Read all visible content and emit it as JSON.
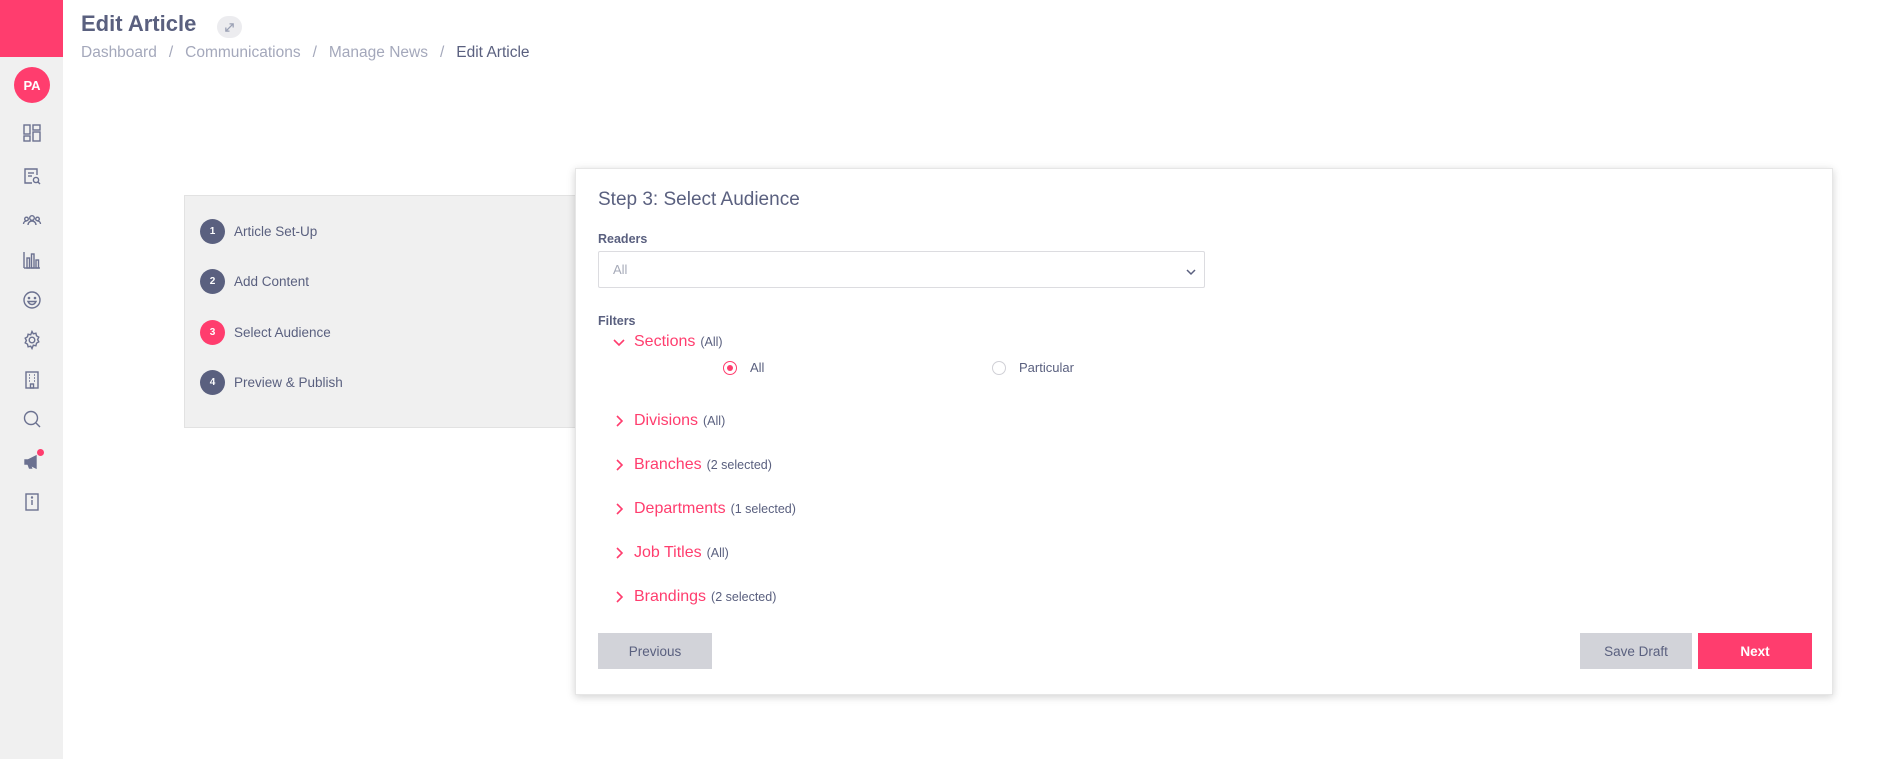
{
  "sidebar": {
    "avatar_initials": "PA",
    "brand_color": "#ff3d6e",
    "icons": [
      {
        "name": "dashboard-icon"
      },
      {
        "name": "document-search-icon"
      },
      {
        "name": "team-icon"
      },
      {
        "name": "analytics-icon"
      },
      {
        "name": "smiley-icon"
      },
      {
        "name": "settings-icon"
      },
      {
        "name": "building-icon"
      },
      {
        "name": "search-icon"
      },
      {
        "name": "megaphone-icon",
        "notification": true
      },
      {
        "name": "directory-icon"
      }
    ]
  },
  "header": {
    "title": "Edit Article",
    "breadcrumb": [
      "Dashboard",
      "Communications",
      "Manage News",
      "Edit Article"
    ],
    "separator": "/"
  },
  "steps": [
    {
      "number": "1",
      "label": "Article Set-Up",
      "active": false
    },
    {
      "number": "2",
      "label": "Add Content",
      "active": false
    },
    {
      "number": "3",
      "label": "Select Audience",
      "active": true
    },
    {
      "number": "4",
      "label": "Preview & Publish",
      "active": false
    }
  ],
  "form": {
    "title": "Step 3: Select Audience",
    "readers_label": "Readers",
    "readers_value": "All",
    "filters_label": "Filters",
    "filters": [
      {
        "name": "Sections",
        "detail": "(All)",
        "expanded": true
      },
      {
        "name": "Divisions",
        "detail": "(All)",
        "expanded": false
      },
      {
        "name": "Branches",
        "detail": "(2 selected)",
        "expanded": false
      },
      {
        "name": "Departments",
        "detail": "(1 selected)",
        "expanded": false
      },
      {
        "name": "Job Titles",
        "detail": "(All)",
        "expanded": false
      },
      {
        "name": "Brandings",
        "detail": "(2 selected)",
        "expanded": false
      }
    ],
    "sections_options": [
      {
        "label": "All",
        "checked": true
      },
      {
        "label": "Particular",
        "checked": false
      }
    ]
  },
  "buttons": {
    "previous": "Previous",
    "save_draft": "Save Draft",
    "next": "Next"
  },
  "colors": {
    "accent": "#ff3d6e",
    "text": "#5a607f",
    "sidebar_bg": "#f0f0f0"
  }
}
